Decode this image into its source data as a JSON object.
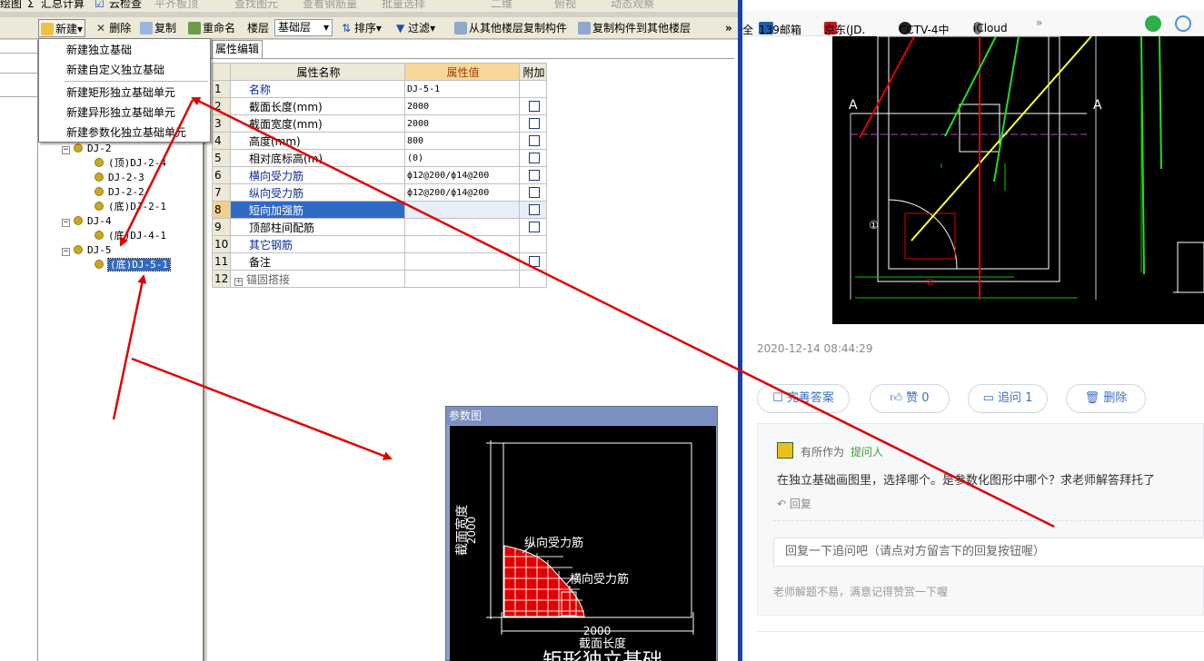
{
  "app": {
    "menubar": {
      "item1": "绘图",
      "sigma": "Σ",
      "item2": "汇总计算",
      "item3": "云检查",
      "item4": "平齐板顶",
      "item5": "查找图元",
      "item6": "查看钢筋量",
      "item7": "批量选择",
      "item8": "二维",
      "item9": "俯视",
      "item10": "动态观察"
    },
    "toolbar": {
      "new_label": "新建",
      "delete_label": "删除",
      "copy_label": "复制",
      "rename_label": "重命名",
      "floor_label": "楼层",
      "floor_value": "基础层",
      "sort_label": "排序",
      "filter_label": "过滤",
      "copy_from_label": "从其他楼层复制构件",
      "copy_to_label": "复制构件到其他楼层",
      "more": "»"
    },
    "left_pane": {
      "close": "ɋ ×"
    },
    "new_menu": [
      "新建独立基础",
      "新建自定义独立基础",
      "新建矩形独立基础单元",
      "新建异形独立基础单元",
      "新建参数化独立基础单元"
    ],
    "tree": [
      {
        "label": "DJ-2",
        "kind": "group"
      },
      {
        "label": "(顶)DJ-2-4",
        "kind": "leaf"
      },
      {
        "label": "DJ-2-3",
        "kind": "leaf"
      },
      {
        "label": "DJ-2-2",
        "kind": "leaf"
      },
      {
        "label": "(底)DJ-2-1",
        "kind": "leaf"
      },
      {
        "label": "DJ-4",
        "kind": "group"
      },
      {
        "label": "(底)DJ-4-1",
        "kind": "leaf"
      },
      {
        "label": "DJ-5",
        "kind": "group"
      },
      {
        "label": "(底)DJ-5-1",
        "kind": "leaf",
        "selected": true
      }
    ],
    "props_tab": "属性编辑",
    "props_headers": {
      "name": "属性名称",
      "value": "属性值",
      "extra": "附加"
    },
    "props": [
      {
        "n": "1",
        "name": "名称",
        "value": "DJ-5-1",
        "blue": true,
        "check": false
      },
      {
        "n": "2",
        "name": "截面长度(mm)",
        "value": "2000",
        "blue": false,
        "check": true
      },
      {
        "n": "3",
        "name": "截面宽度(mm)",
        "value": "2000",
        "blue": false,
        "check": true
      },
      {
        "n": "4",
        "name": "高度(mm)",
        "value": "800",
        "blue": false,
        "check": true
      },
      {
        "n": "5",
        "name": "相对底标高(m)",
        "value": "(0)",
        "blue": false,
        "check": true
      },
      {
        "n": "6",
        "name": "横向受力筋",
        "value": "ф12@200/ф14@200",
        "blue": true,
        "check": true
      },
      {
        "n": "7",
        "name": "纵向受力筋",
        "value": "ф12@200/ф14@200",
        "blue": true,
        "check": true
      },
      {
        "n": "8",
        "name": "短向加强筋",
        "value": "",
        "blue": true,
        "check": true,
        "selected": true
      },
      {
        "n": "9",
        "name": "顶部柱间配筋",
        "value": "",
        "blue": false,
        "check": true
      },
      {
        "n": "10",
        "name": "其它钢筋",
        "value": "",
        "blue": true,
        "check": false
      },
      {
        "n": "11",
        "name": "备注",
        "value": "",
        "blue": false,
        "check": true
      },
      {
        "n": "12",
        "name": "锚固搭接",
        "value": "",
        "blue": false,
        "check": false,
        "expand": "+"
      }
    ],
    "param_window": {
      "title": "参数图",
      "label_width": "截面宽度",
      "dim_width": "2000",
      "label_long": "纵向受力筋",
      "label_trans": "横向受力筋",
      "dim_length": "2000",
      "label_length": "截面长度",
      "caption": "矩形独立基础"
    }
  },
  "browser": {
    "bookmarks": [
      {
        "icon": "qr-icon",
        "label": "全"
      },
      {
        "icon": "mail-139-icon",
        "label": "139邮箱"
      },
      {
        "icon": "jd-icon",
        "label": "京东(JD."
      },
      {
        "icon": "cctv-icon",
        "label": "CCTV-4中"
      },
      {
        "icon": "apple-icon",
        "label": "iCloud"
      },
      {
        "icon": "chevron-icon",
        "label": "»"
      }
    ],
    "cad_labels": {
      "section_a": "A",
      "marker1": "①",
      "marker2": "②"
    },
    "timestamp": "2020-12-14 08:44:29",
    "actions": {
      "improve": "完善答案",
      "like": "赞 0",
      "followup": "追问 1",
      "delete": "删除"
    },
    "comment": {
      "user": "有所作为",
      "role": "提问人",
      "text": "在独立基础画图里，选择哪个。是参数化图形中哪个？求老师解答拜托了",
      "reply": "回复",
      "input_placeholder": "回复一下追问吧（请点对方留言下的回复按钮喔）",
      "footer": "老师解题不易，满意记得赞赏一下喔"
    },
    "colors": {
      "accent": "#3a6fc4",
      "role_green": "#3aa33a"
    }
  }
}
